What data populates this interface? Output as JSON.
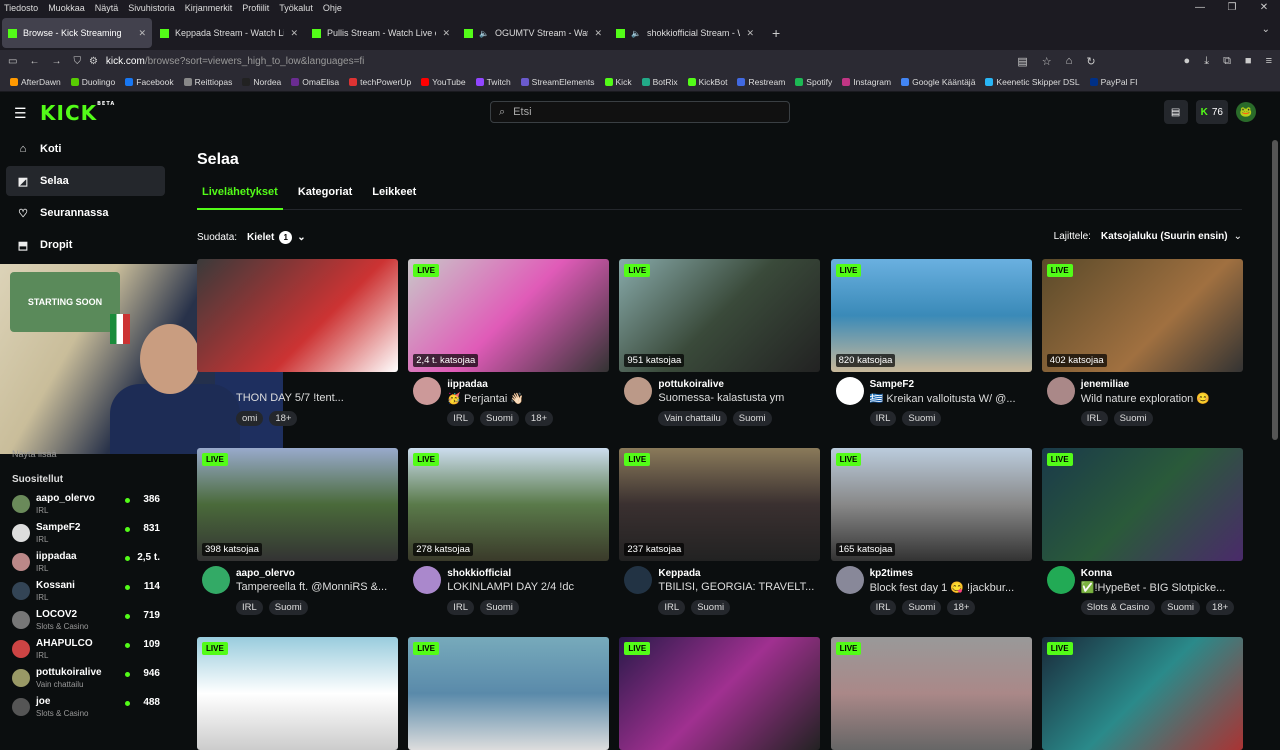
{
  "menubar": {
    "items": [
      "Tiedosto",
      "Muokkaa",
      "Näytä",
      "Sivuhistoria",
      "Kirjanmerkit",
      "Profiilit",
      "Työkalut",
      "Ohje"
    ]
  },
  "tabs": [
    {
      "title": "Browse - Kick Streaming",
      "active": true
    },
    {
      "title": "Keppada Stream - Watch Live on",
      "active": false
    },
    {
      "title": "Pullis Stream - Watch Live on Ki",
      "active": false
    },
    {
      "title": "OGUMTV Stream - Watch L",
      "active": false
    },
    {
      "title": "shokkiofficial Stream - Watc",
      "active": false
    }
  ],
  "url": {
    "host": "kick.com",
    "path": "/browse?sort=viewers_high_to_low&languages=fi"
  },
  "bookmarks": [
    "AfterDawn",
    "Duolingo",
    "Facebook",
    "Reittiopas",
    "Nordea",
    "OmaElisa",
    "techPowerUp",
    "YouTube",
    "Twitch",
    "StreamElements",
    "Kick",
    "BotRix",
    "KickBot",
    "Restream",
    "Spotify",
    "Instagram",
    "Google Kääntäjä",
    "Keenetic Skipper DSL",
    "PayPal FI"
  ],
  "header": {
    "logo": "KICK",
    "logo_beta": "BETA",
    "search_placeholder": "Etsi",
    "coins": "76"
  },
  "sidebar": {
    "nav": [
      {
        "label": "Koti",
        "icon": "home-icon"
      },
      {
        "label": "Selaa",
        "icon": "browse-icon"
      },
      {
        "label": "Seurannassa",
        "icon": "heart-icon"
      },
      {
        "label": "Dropit",
        "icon": "drops-icon"
      }
    ],
    "webcam_sign": "STARTING SOON",
    "show_all": "Näytä lisää",
    "suggested_title": "Suositellut",
    "suggested": [
      {
        "name": "aapo_olervo",
        "category": "IRL",
        "viewers": "386"
      },
      {
        "name": "SampeF2",
        "category": "IRL",
        "viewers": "831"
      },
      {
        "name": "iippadaa",
        "category": "IRL",
        "viewers": "2,5 t."
      },
      {
        "name": "Kossani",
        "category": "IRL",
        "viewers": "114"
      },
      {
        "name": "LOCOV2",
        "category": "Slots & Casino",
        "viewers": "719"
      },
      {
        "name": "AHAPULCO",
        "category": "IRL",
        "viewers": "109"
      },
      {
        "name": "pottukoiralive",
        "category": "Vain chattailu",
        "viewers": "946"
      },
      {
        "name": "joe",
        "category": "Slots & Casino",
        "viewers": "488"
      }
    ]
  },
  "main": {
    "title": "Selaa",
    "tabs": [
      "Livelähetykset",
      "Kategoriat",
      "Leikkeet"
    ],
    "filter_label": "Suodata:",
    "filter_button": "Kielet",
    "filter_count": "1",
    "sort_label": "Lajittele:",
    "sort_value": "Katsojaluku (Suurin ensin)",
    "live_label": "LIVE",
    "cards": [
      {
        "name": "",
        "title": "THON DAY 5/7 !tent...",
        "viewers": "",
        "tags": [
          "omi",
          "18+"
        ]
      },
      {
        "name": "iippadaa",
        "title": "🥳 Perjantai 👋🏻",
        "viewers": "2,4 t. katsojaa",
        "tags": [
          "IRL",
          "Suomi",
          "18+"
        ]
      },
      {
        "name": "pottukoiralive",
        "title": "Suomessa- kalastusta ym",
        "viewers": "951 katsojaa",
        "tags": [
          "Vain chattailu",
          "Suomi"
        ]
      },
      {
        "name": "SampeF2",
        "title": "🇬🇷 Kreikan valloitusta W/ @...",
        "viewers": "820 katsojaa",
        "tags": [
          "IRL",
          "Suomi"
        ]
      },
      {
        "name": "jenemiliae",
        "title": "Wild nature exploration 😊",
        "viewers": "402 katsojaa",
        "tags": [
          "IRL",
          "Suomi"
        ]
      },
      {
        "name": "aapo_olervo",
        "title": "Tampereella ft. @MonniRS &...",
        "viewers": "398 katsojaa",
        "tags": [
          "IRL",
          "Suomi"
        ]
      },
      {
        "name": "shokkiofficial",
        "title": "LOKINLAMPI DAY 2/4 !dc",
        "viewers": "278 katsojaa",
        "tags": [
          "IRL",
          "Suomi"
        ]
      },
      {
        "name": "Keppada",
        "title": "TBILISI, GEORGIA: TRAVELT...",
        "viewers": "237 katsojaa",
        "tags": [
          "IRL",
          "Suomi"
        ]
      },
      {
        "name": "kp2times",
        "title": "Block fest day 1 😋 !jackbur...",
        "viewers": "165 katsojaa",
        "tags": [
          "IRL",
          "Suomi",
          "18+"
        ]
      },
      {
        "name": "Konna",
        "title": "✅!HypeBet - BIG Slotpicke...",
        "viewers": "",
        "tags": [
          "Slots & Casino",
          "Suomi",
          "18+"
        ]
      },
      {
        "name": "",
        "title": "",
        "viewers": "",
        "tags": []
      },
      {
        "name": "",
        "title": "",
        "viewers": "",
        "tags": []
      },
      {
        "name": "",
        "title": "",
        "viewers": "",
        "tags": []
      },
      {
        "name": "",
        "title": "",
        "viewers": "",
        "tags": []
      },
      {
        "name": "",
        "title": "",
        "viewers": "",
        "tags": []
      }
    ]
  },
  "colors": {
    "accent": "#53fc18",
    "bg": "#0b0e0f",
    "tag_bg": "#24272c"
  }
}
